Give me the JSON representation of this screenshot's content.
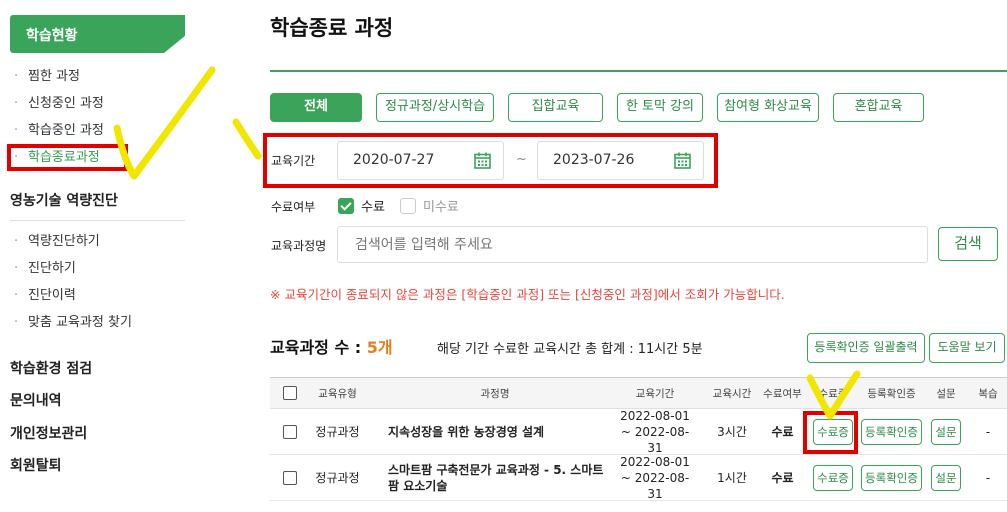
{
  "sidebar": {
    "header": "학습현황",
    "study_items": [
      "찜한 과정",
      "신청중인 과정",
      "학습중인 과정",
      "학습종료과정"
    ],
    "section_diag": "영농기술 역량진단",
    "diag_items": [
      "역량진단하기",
      "진단하기",
      "진단이력",
      "맞춤 교육과정 찾기"
    ],
    "section_env": "학습환경 점검",
    "section_inquiry": "문의내역",
    "section_profile": "개인정보관리",
    "section_withdraw": "회원탈퇴"
  },
  "main": {
    "title": "학습종료 과정",
    "tabs": [
      "전체",
      "정규과정/상시학습",
      "집합교육",
      "한 토막 강의",
      "참여형 화상교육",
      "혼합교육"
    ],
    "period_label": "교육기간",
    "date_start": "2020-07-27",
    "date_sep": "~",
    "date_end": "2023-07-26",
    "completion_label": "수료여부",
    "opt_complete": "수료",
    "opt_incomplete": "미수료",
    "course_name_label": "교육과정명",
    "search_placeholder": "검색어를 입력해 주세요",
    "search_button": "검색",
    "notice": "※ 교육기간이 종료되지 않은 과정은 [학습중인 과정] 또는 [신청중인 과정]에서 조회가 가능합니다.",
    "count_label": "교육과정 수 : ",
    "count_value": "5개",
    "total_text": "해당 기간 수료한 교육시간 총 합계 : 11시간 5분",
    "bulk_print_button": "등록확인증 일괄출력",
    "help_button": "도움말 보기"
  },
  "table": {
    "headers": [
      "교육유형",
      "과정명",
      "교육기간",
      "교육시간",
      "수료여부",
      "수료증",
      "등록확인증",
      "설문",
      "복습"
    ],
    "rows": [
      {
        "type": "정규과정",
        "name": "지속성장을 위한 농장경영 설계",
        "period_start": "2022-08-01",
        "period_end": "~ 2022-08-31",
        "hours": "3시간",
        "status": "수료",
        "cert": "수료증",
        "reg_cert": "등록확인증",
        "survey": "설문",
        "review": "-"
      },
      {
        "type": "정규과정",
        "name": "스마트팜 구축전문가 교육과정 - 5. 스마트팜 요소기술",
        "period_start": "2022-08-01",
        "period_end": "~ 2022-08-31",
        "hours": "1시간",
        "status": "수료",
        "cert": "수료증",
        "reg_cert": "등록확인증",
        "survey": "설문",
        "review": "-"
      }
    ]
  },
  "colors": {
    "accent_green": "#3aa55a",
    "annotation_red": "#e10000",
    "highlight_yellow": "#f2e600",
    "count_orange": "#f07a1c"
  }
}
